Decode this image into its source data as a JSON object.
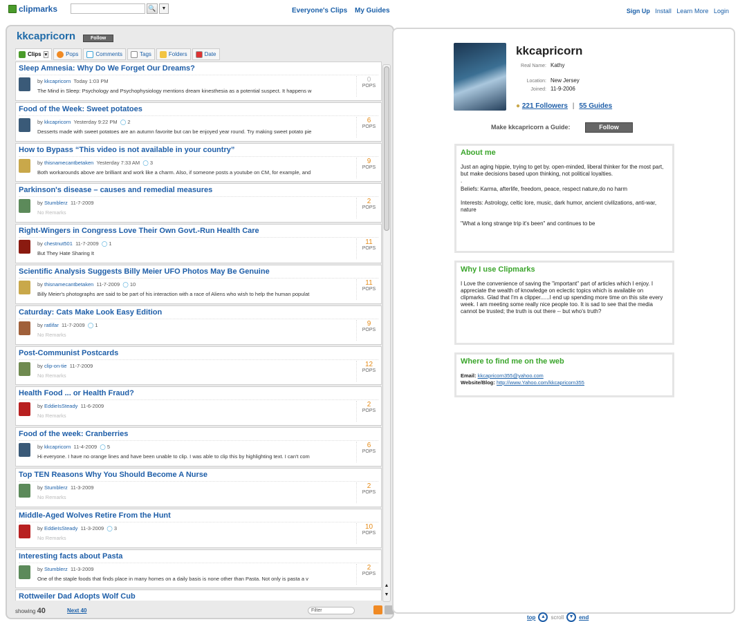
{
  "topbar": {
    "logo": "clipmarks",
    "nav_center": [
      "Everyone's Clips",
      "My Guides"
    ],
    "signup": "Sign Up",
    "install": "Install",
    "learn_more": "Learn More",
    "login": "Login"
  },
  "left": {
    "username": "kkcapricorn",
    "follow": "Follow",
    "tabs": [
      "Clips",
      "Pops",
      "Comments",
      "Tags",
      "Folders",
      "Date"
    ],
    "clips": [
      {
        "title": "Sleep Amnesia: Why Do We Forget Our Dreams?",
        "by": "by",
        "user": "kkcapricorn",
        "time": "Today 1:03 PM",
        "comments": "",
        "remark": "The Mind in Sleep: Psychology and Psychophysiology mentions dream kinesthesia as a potential suspect. It happens w",
        "pops": "0",
        "pops_label": "POPS",
        "thumb": "#3a5a78"
      },
      {
        "title": "Food of the Week: Sweet potatoes",
        "by": "by",
        "user": "kkcapricorn",
        "time": "Yesterday 9:22 PM",
        "comments": "2",
        "remark": "Desserts made with sweet potatoes are an autumn favorite but can be enjoyed year round. Try making sweet potato pie",
        "pops": "6",
        "pops_label": "POPS",
        "thumb": "#3a5a78"
      },
      {
        "title": "How to Bypass “This video is not available in your country”",
        "by": "by",
        "user": "thisnamecantbetaken",
        "time": "Yesterday 7:33 AM",
        "comments": "3",
        "remark": "Both workarounds above are brilliant and work like a charm. Also, if someone posts a youtube on CM, for example, and",
        "pops": "9",
        "pops_label": "POPS",
        "thumb": "#c9a84a"
      },
      {
        "title": "Parkinson's disease – causes and remedial measures",
        "by": "by",
        "user": "Stumblerz",
        "time": "11-7-2009",
        "comments": "",
        "remark": "No Remarks",
        "pops": "2",
        "pops_label": "POPS",
        "thumb": "#5c8a5a"
      },
      {
        "title": "Right-Wingers in Congress Love Their Own Govt.-Run Health Care",
        "by": "by",
        "user": "chestnut501",
        "time": "11-7-2009",
        "comments": "1",
        "remark": "But They Hate Sharing It",
        "pops": "11",
        "pops_label": "POPS",
        "thumb": "#8a1a10"
      },
      {
        "title": "Scientific Analysis Suggests Billy Meier UFO Photos May Be Genuine",
        "by": "by",
        "user": "thisnamecantbetaken",
        "time": "11-7-2009",
        "comments": "10",
        "remark": "Billy Meier's photographs are said to be part of his interaction with a race of Aliens who wish to help the human populat",
        "pops": "11",
        "pops_label": "POPS",
        "thumb": "#c9a84a"
      },
      {
        "title": "Caturday: Cats Make Look Easy Edition",
        "by": "by",
        "user": "ratlifar",
        "time": "11-7-2009",
        "comments": "1",
        "remark": "No Remarks",
        "pops": "9",
        "pops_label": "POPS",
        "thumb": "#a0603a"
      },
      {
        "title": "Post-Communist Postcards",
        "by": "by",
        "user": "clip-on-tie",
        "time": "11-7-2009",
        "comments": "",
        "remark": "No Remarks",
        "pops": "12",
        "pops_label": "POPS",
        "thumb": "#6f8a50"
      },
      {
        "title": "Health Food ... or Health Fraud?",
        "by": "by",
        "user": "EddieIsSteady",
        "time": "11-6-2009",
        "comments": "",
        "remark": "No Remarks",
        "pops": "2",
        "pops_label": "POPS",
        "thumb": "#b82020"
      },
      {
        "title": "Food of the week: Cranberries",
        "by": "by",
        "user": "kkcapricorn",
        "time": "11-4-2009",
        "comments": "5",
        "remark": "Hi everyone. I have no orange lines and have been unable to clip. I was able to clip this by highlighting text. I can't com",
        "pops": "6",
        "pops_label": "POPS",
        "thumb": "#3a5a78"
      },
      {
        "title": "Top TEN Reasons Why You Should Become A Nurse",
        "by": "by",
        "user": "Stumblerz",
        "time": "11-3-2009",
        "comments": "",
        "remark": "No Remarks",
        "pops": "2",
        "pops_label": "POPS",
        "thumb": "#5c8a5a"
      },
      {
        "title": "Middle-Aged Wolves Retire From the Hunt",
        "by": "by",
        "user": "EddieIsSteady",
        "time": "11-3-2009",
        "comments": "3",
        "remark": "No Remarks",
        "pops": "10",
        "pops_label": "POPS",
        "thumb": "#b82020"
      },
      {
        "title": "Interesting facts about Pasta",
        "by": "by",
        "user": "Stumblerz",
        "time": "11-3-2009",
        "comments": "",
        "remark": "One of the staple foods that finds place in many homes on a daily basis is none other than Pasta. Not only is pasta a v",
        "pops": "2",
        "pops_label": "POPS",
        "thumb": "#5c8a5a"
      },
      {
        "title": "Rottweiler Dad Adopts Wolf Cub",
        "by": "",
        "user": "",
        "time": "",
        "comments": "",
        "remark": "",
        "pops": "",
        "pops_label": "",
        "thumb": ""
      }
    ],
    "showing_label": "showing",
    "showing_count": "40",
    "next": "Next 40",
    "filter_placeholder": "Filter"
  },
  "profile": {
    "name": "kkcapricorn",
    "real_name_label": "Real Name:",
    "real_name": "Kathy",
    "location_label": "Location:",
    "location": "New Jersey",
    "joined_label": "Joined:",
    "joined": "11-9-2006",
    "followers": "221 Followers",
    "guides": "55 Guides",
    "make_guide": "Make kkcapricorn a Guide:",
    "follow": "Follow",
    "about_title": "About me",
    "about_p1": "Just an aging hippie, trying to get by. open-minded, liberal thinker for the most part, but make decisions based upon thinking, not political loyalties.",
    "about_p2": ".",
    "about_p3": "Beliefs: Karma, afterlife, freedom, peace, respect nature,do no harm",
    "about_p4": "Interests: Astrology, celtic lore, music, dark humor, ancient civilizations, anti-war, nature",
    "about_p5": "\"What a long strange trip it's been\" and continues to be",
    "why_title": "Why I use Clipmarks",
    "why_p": "I Love the convenience of saving the \"important\" part of articles which I enjoy. I appreciate the wealth of knowledge on eclectic topics which is available on clipmarks. Glad that I'm a clipper......I end up spending more time on this site every week. I am meeting some really nice people too. It is sad to see that the media cannot be trusted; the truth is out there -- but who's truth?",
    "web_title": "Where to find me on the web",
    "email_label": "Email:",
    "email": "kkcapricorn355@yahoo.com",
    "site_label": "Website/Blog:",
    "site": "http://www.Yahoo.com/kkcapricorn355"
  },
  "scrollnav": {
    "top": "top",
    "scroll": "scroll",
    "end": "end"
  }
}
